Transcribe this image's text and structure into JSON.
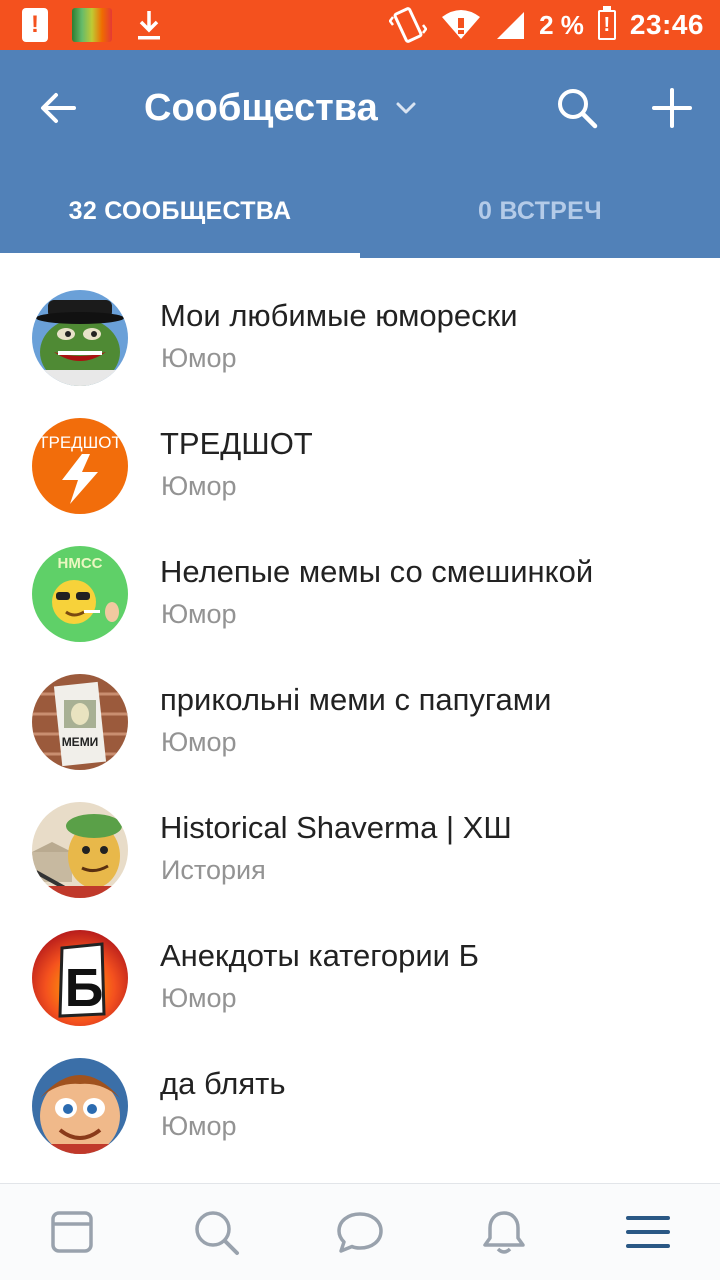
{
  "status_bar": {
    "battery_percent": "2 %",
    "time": "23:46",
    "icons": [
      "alert-icon",
      "avast-icon",
      "download-icon",
      "vibrate-icon",
      "wifi-icon",
      "signal-icon",
      "battery-icon"
    ]
  },
  "header": {
    "title": "Сообщества",
    "icons": [
      "back-arrow-icon",
      "chevron-down-icon",
      "search-icon",
      "plus-icon"
    ]
  },
  "tabs": [
    {
      "label": "32 СООБЩЕСТВА",
      "active": true
    },
    {
      "label": "0 ВСТРЕЧ",
      "active": false
    }
  ],
  "communities": [
    {
      "name": "Мои любимые юморески",
      "category": "Юмор",
      "avatar": "pepe-avatar"
    },
    {
      "name": "ТРЕДШОТ",
      "category": "Юмор",
      "avatar": "tredshot-avatar",
      "avatar_text": "ТРЕДШОТ"
    },
    {
      "name": "Нелепые мемы со смешинкой",
      "category": "Юмор",
      "avatar": "nmss-avatar",
      "avatar_text": "НМСС"
    },
    {
      "name": "прикольні меми с папугами",
      "category": "Юмор",
      "avatar": "parrot-avatar",
      "avatar_text": "МЕМИ"
    },
    {
      "name": "Historical Shaverma | ХШ",
      "category": "История",
      "avatar": "shaverma-avatar"
    },
    {
      "name": "Анекдоты категории Б",
      "category": "Юмор",
      "avatar": "anekdoty-avatar",
      "avatar_text": "Б"
    },
    {
      "name": "да блять",
      "category": "Юмор",
      "avatar": "cartoon-boy-avatar"
    }
  ],
  "bottom_nav": [
    "news-icon",
    "search-icon",
    "messages-icon",
    "notifications-icon",
    "menu-icon"
  ],
  "colors": {
    "status_bar": "#f4511e",
    "header": "#5181b8",
    "active_nav": "#2a5885",
    "inactive_nav": "#99a2ad"
  }
}
